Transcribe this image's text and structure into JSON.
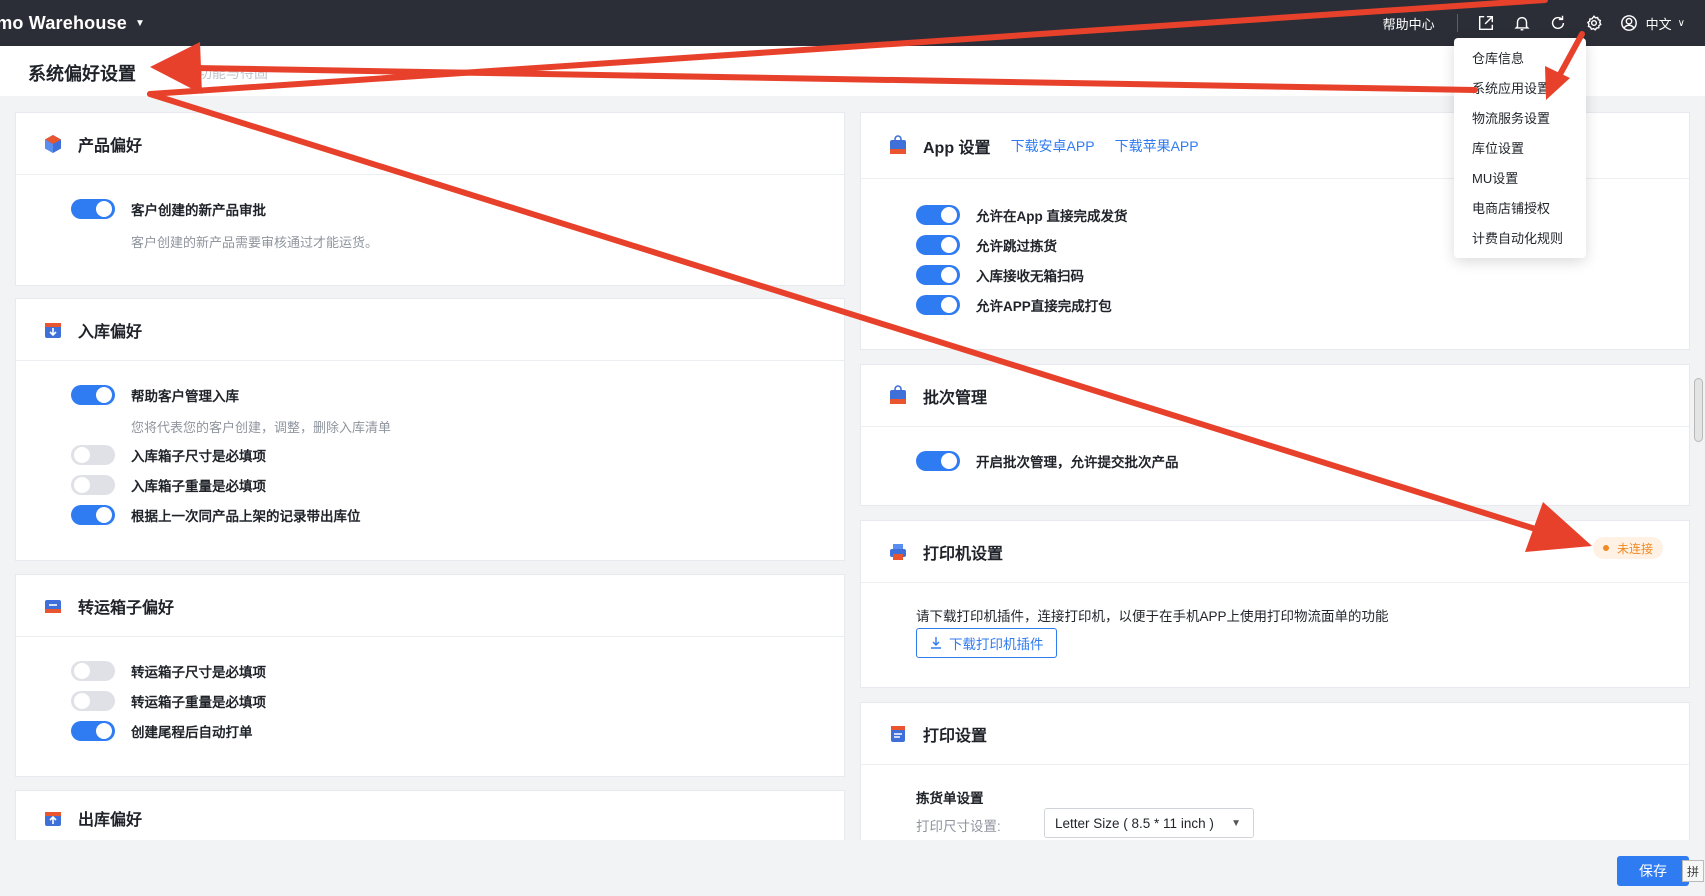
{
  "topbar": {
    "brand": "emo Warehouse",
    "help": "帮助中心",
    "language": "中文",
    "icons": [
      "export-icon",
      "bell-icon",
      "refresh-icon",
      "gear-icon",
      "user-icon"
    ]
  },
  "page": {
    "title": "系统偏好设置",
    "subtitle": "功能与待固"
  },
  "dropdown": {
    "items": [
      "仓库信息",
      "系统应用设置",
      "物流服务设置",
      "库位设置",
      "MU设置",
      "电商店铺授权",
      "计费自动化规则"
    ]
  },
  "product_pref": {
    "title": "产品偏好",
    "toggle_label": "客户创建的新产品审批",
    "toggle_on": true,
    "desc": "客户创建的新产品需要审核通过才能运货。"
  },
  "inbound_pref": {
    "title": "入库偏好",
    "rows": [
      {
        "label": "帮助客户管理入库",
        "on": true
      },
      {
        "label": "入库箱子尺寸是必填项",
        "on": false
      },
      {
        "label": "入库箱子重量是必填项",
        "on": false
      },
      {
        "label": "根据上一次同产品上架的记录带出库位",
        "on": true
      }
    ],
    "desc": "您将代表您的客户创建，调整，删除入库清单"
  },
  "transfer_pref": {
    "title": "转运箱子偏好",
    "rows": [
      {
        "label": "转运箱子尺寸是必填项",
        "on": false
      },
      {
        "label": "转运箱子重量是必填项",
        "on": false
      },
      {
        "label": "创建尾程后自动打单",
        "on": true
      }
    ]
  },
  "outbound_pref": {
    "title": "出库偏好"
  },
  "app_settings": {
    "title": "App 设置",
    "link_android": "下载安卓APP",
    "link_ios": "下载苹果APP",
    "rows": [
      {
        "label": "允许在App 直接完成发货",
        "on": true
      },
      {
        "label": "允许跳过拣货",
        "on": true
      },
      {
        "label": "入库接收无箱扫码",
        "on": true
      },
      {
        "label": "允许APP直接完成打包",
        "on": true
      }
    ]
  },
  "batch": {
    "title": "批次管理",
    "toggle_label": "开启批次管理，允许提交批次产品",
    "toggle_on": true
  },
  "printer": {
    "title": "打印机设置",
    "status": "未连接",
    "desc": "请下载打印机插件，连接打印机，以便于在手机APP上使用打印物流面单的功能",
    "download_btn": "下载打印机插件"
  },
  "print_settings": {
    "title": "打印设置",
    "section": "拣货单设置",
    "size_label": "打印尺寸设置:",
    "size_value": "Letter Size ( 8.5 * 11 inch )"
  },
  "footer": {
    "save": "保存",
    "ime": "拼"
  },
  "colors": {
    "primary": "#2f7bf2",
    "arrow": "#e8412b",
    "topbar": "#2b2e36"
  }
}
